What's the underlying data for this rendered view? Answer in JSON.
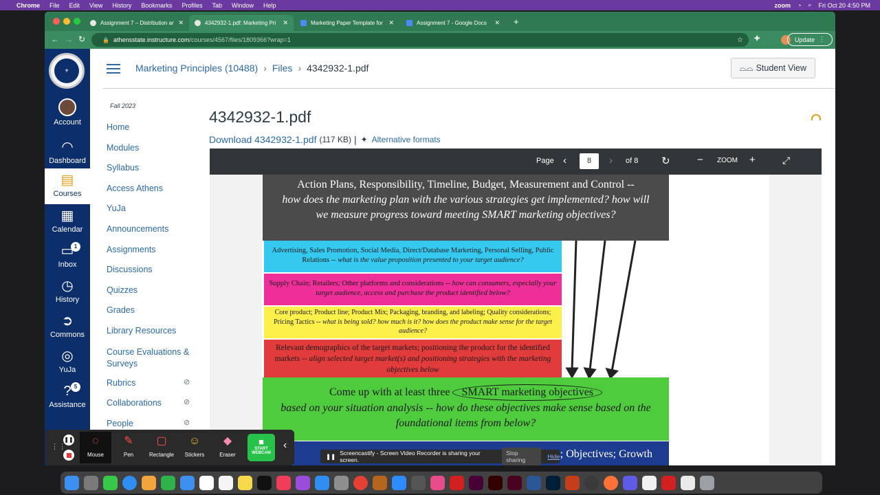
{
  "menubar": {
    "app": "Chrome",
    "items": [
      "File",
      "Edit",
      "View",
      "History",
      "Bookmarks",
      "Profiles",
      "Tab",
      "Window",
      "Help"
    ],
    "zoom": "zoom",
    "clock": "Fri Oct 20  4:50 PM"
  },
  "browser": {
    "tabs": [
      {
        "title": "Assignment 7 – Distribution an"
      },
      {
        "title": "4342932-1.pdf: Marketing Pri"
      },
      {
        "title": "Marketing Paper Template for"
      },
      {
        "title": "Assignment 7 - Google Docs"
      }
    ],
    "url_host": "athensstate.instructure.com",
    "url_path": "/courses/4567/files/1809366?wrap=1",
    "update_label": "Update"
  },
  "global_nav": {
    "items": [
      {
        "label": "Account"
      },
      {
        "label": "Dashboard"
      },
      {
        "label": "Courses"
      },
      {
        "label": "Calendar"
      },
      {
        "label": "Inbox",
        "badge": "1"
      },
      {
        "label": "History"
      },
      {
        "label": "Commons"
      },
      {
        "label": "YuJa"
      },
      {
        "label": "Assistance",
        "badge": "5"
      }
    ]
  },
  "breadcrumb": {
    "course": "Marketing Principles (10488)",
    "section": "Files",
    "file": "4342932-1.pdf"
  },
  "student_view_label": "Student View",
  "course_nav": {
    "term": "Fall 2023",
    "items": [
      "Home",
      "Modules",
      "Syllabus",
      "Access Athens",
      "YuJa",
      "Announcements",
      "Assignments",
      "Discussions",
      "Quizzes",
      "Grades",
      "Library Resources",
      "Course Evaluations & Surveys",
      "Rubrics",
      "Collaborations",
      "People"
    ]
  },
  "file": {
    "title": "4342932-1.pdf",
    "download_label": "Download 4342932-1.pdf",
    "size": "(117 KB)",
    "sep": "|",
    "alt_formats": "Alternative formats"
  },
  "pdf_toolbar": {
    "page_label": "Page",
    "page_value": "8",
    "of_label": "of 8",
    "zoom_label": "ZOOM"
  },
  "pdf_content": {
    "header_line1": "Action Plans, Responsibility, Timeline, Budget, Measurement and Control --",
    "header_line2": "how does the marketing plan with the various strategies get implemented? how will we measure progress toward meeting SMART marketing objectives?",
    "band1_plain": "Advertising, Sales Promotion, Social Media, Direct/Database Marketing, Personal Selling, Public Relations -- ",
    "band1_italic": "what is the value proposition presented to your target audience?",
    "band2_plain": "Supply Chain; Retailers; Other platforms and considerations -- ",
    "band2_italic": "how can consumers, especially your target audience,  access and purchase the product identified below?",
    "band3_plain": "Core product; Product line; Product Mix; Packaging, branding, and labeling; Quality considerations; Pricing Tactics -- ",
    "band3_italic": "what is being sold? how much is it? how does the product make sense for the target audience?",
    "band4_plain": "Relevant demographics of the target markets; positioning the product for the identified markets -- ",
    "band4_italic": "align selected target market(s) and positioning strategies with  the marketing objectives below",
    "green_plain": "Come up with at least three ",
    "green_oval": "SMART marketing objectives",
    "green_italic": "based on your situation analysis -- how do these objectives make sense based on the foundational items from below?",
    "blue_partial": "Mission; Objectives; Growth"
  },
  "recorder": {
    "tools": [
      "Mouse",
      "Pen",
      "Rectangle",
      "Stickers",
      "Eraser"
    ],
    "webcam": "START WEBCAM"
  },
  "share_bar": {
    "message": "Screencastify - Screen Video Recorder is sharing your screen.",
    "stop": "Stop sharing",
    "hide": "Hide"
  },
  "colors": {
    "menubar": "#6a3aa0",
    "chrome_frame": "#2f7a52",
    "canvas_nav": "#0c2f6b",
    "link": "#2b6aa8",
    "band_cyan": "#35c9ef",
    "band_magenta": "#ee2f9a",
    "band_yellow": "#fdf04a",
    "band_red": "#e23b3b",
    "band_green": "#4fcc3e"
  }
}
